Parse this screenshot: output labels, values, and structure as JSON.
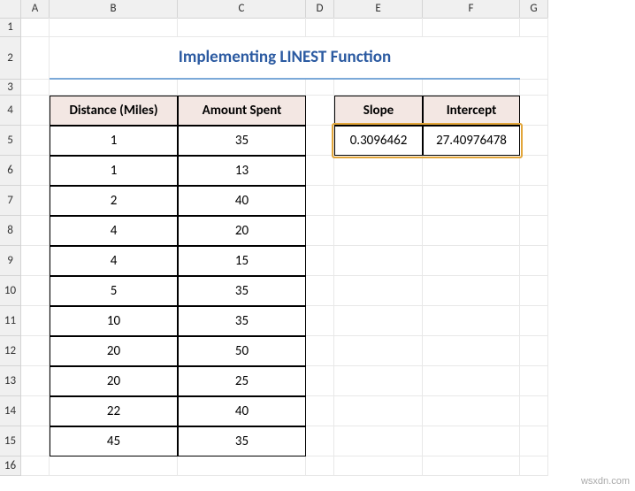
{
  "columns": [
    "A",
    "B",
    "C",
    "D",
    "E",
    "F",
    "G"
  ],
  "title": "Implementing LINEST Function",
  "table1": {
    "headers": [
      "Distance (Miles)",
      "Amount Spent"
    ],
    "rows": [
      [
        "1",
        "35"
      ],
      [
        "1",
        "13"
      ],
      [
        "2",
        "40"
      ],
      [
        "4",
        "20"
      ],
      [
        "4",
        "15"
      ],
      [
        "5",
        "35"
      ],
      [
        "10",
        "35"
      ],
      [
        "20",
        "50"
      ],
      [
        "20",
        "25"
      ],
      [
        "22",
        "40"
      ],
      [
        "45",
        "35"
      ]
    ]
  },
  "table2": {
    "headers": [
      "Slope",
      "Intercept"
    ],
    "values": [
      "0.3096462",
      "27.40976478"
    ]
  },
  "watermark": "wsxdn.com"
}
